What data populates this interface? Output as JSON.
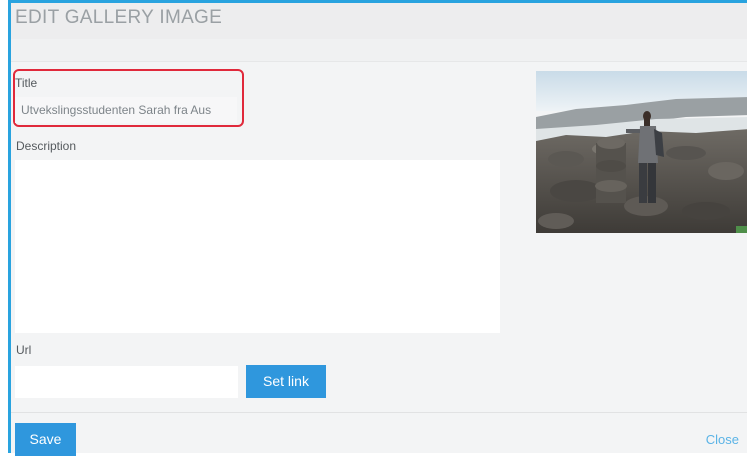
{
  "dialog": {
    "title": "EDIT GALLERY IMAGE"
  },
  "form": {
    "title_label": "Title",
    "title_value": "Utvekslingsstudenten Sarah fra Aus",
    "description_label": "Description",
    "description_value": "",
    "url_label": "Url",
    "url_value": "",
    "set_link_label": "Set link"
  },
  "footer": {
    "save_label": "Save",
    "close_label": "Close"
  },
  "colors": {
    "accent": "#2f97dd",
    "frame": "#29a3df",
    "highlight": "#e0293b"
  },
  "image": {
    "subject": "person-standing-on-rocky-terrain-photo"
  }
}
